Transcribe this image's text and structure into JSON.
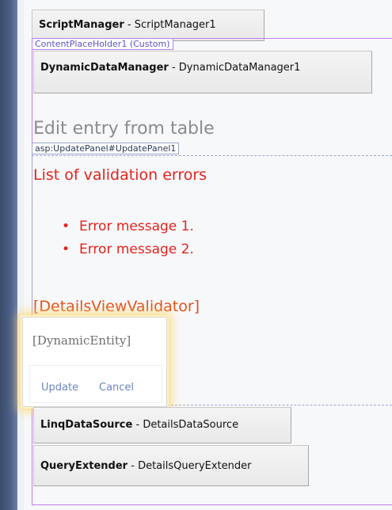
{
  "script_manager": {
    "type": "ScriptManager",
    "separator": " - ",
    "id": "ScriptManager1"
  },
  "content_placeholder": {
    "tag": "ContentPlaceHolder1 (Custom)"
  },
  "dynamic_data_manager": {
    "type": "DynamicDataManager",
    "separator": " - ",
    "id": "DynamicDataManager1"
  },
  "page_title": "Edit entry from table",
  "update_panel": {
    "tag": "asp:UpdatePanel#UpdatePanel1"
  },
  "validation": {
    "title": "List of validation errors",
    "bullet": "•",
    "errors": [
      "Error message 1.",
      "Error message 2."
    ]
  },
  "details_view_validator": "[DetailsViewValidator]",
  "details_view": {
    "entity_placeholder": "[DynamicEntity]",
    "update_label": "Update",
    "cancel_label": "Cancel"
  },
  "linq_data_source": {
    "type": "LinqDataSource",
    "separator": " - ",
    "id": "DetailsDataSource"
  },
  "query_extender": {
    "type": "QueryExtender",
    "separator": " - ",
    "id": "DetailsQueryExtender"
  },
  "colors": {
    "error_red": "#e3241c",
    "validator_orange": "#e3501c",
    "link_blue": "#6b86c4",
    "content_frame_purple": "#c27ee6",
    "update_frame_blue": "#9aa9c9"
  }
}
